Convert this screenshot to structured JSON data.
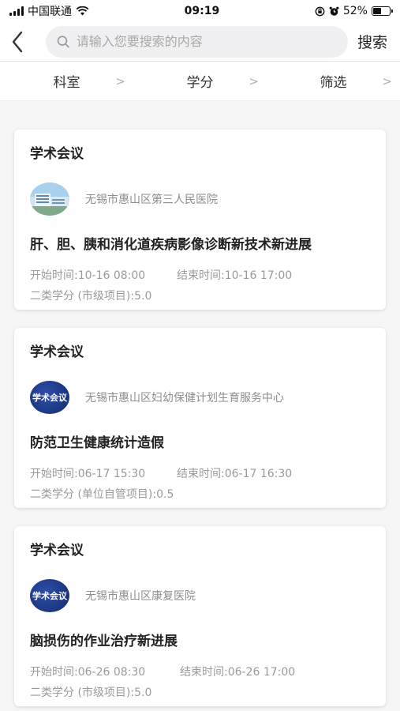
{
  "status_bar": {
    "carrier": "中国联通",
    "time": "09:19",
    "battery_text": "52%",
    "battery_level": 0.52
  },
  "header": {
    "search_placeholder": "请输入您要搜索的内容",
    "search_label": "搜索"
  },
  "filters": [
    {
      "label": "科室"
    },
    {
      "label": "学分"
    },
    {
      "label": "筛选"
    }
  ],
  "cards": [
    {
      "type": "学术会议",
      "org": "无锡市惠山区第三人民医院",
      "logo": "hospital-building",
      "title": "肝、胆、胰和消化道疾病影像诊断新技术新进展",
      "start": "开始时间:10-16 08:00",
      "end": "结束时间:10-16 17:00",
      "credit": "二类学分 (市级项目):5.0"
    },
    {
      "type": "学术会议",
      "org": "无锡市惠山区妇幼保健计划生育服务中心",
      "logo": "academic-conference-badge",
      "logo_text": "学术会议",
      "title": "防范卫生健康统计造假",
      "start": "开始时间:06-17 15:30",
      "end": "结束时间:06-17 16:30",
      "credit": "二类学分 (单位自管项目):0.5"
    },
    {
      "type": "学术会议",
      "org": "无锡市惠山区康复医院",
      "logo": "academic-conference-badge",
      "logo_text": "学术会议",
      "title": "脑损伤的作业治疗新进展",
      "start": "开始时间:06-26 08:30",
      "end": "结束时间:06-26 17:00",
      "credit": "二类学分 (市级项目):5.0"
    }
  ]
}
